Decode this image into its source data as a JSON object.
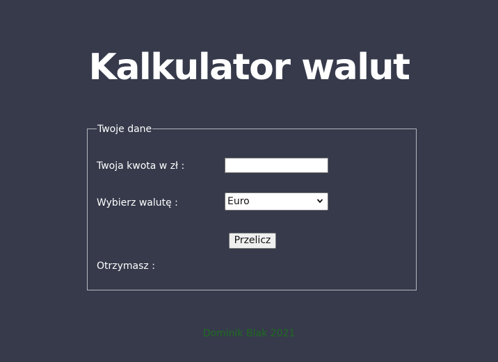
{
  "header": {
    "title": "Kalkulator walut"
  },
  "form": {
    "legend": "Twoje dane",
    "amount_label": "Twoja kwota w zł :",
    "amount_value": "",
    "currency_label": "Wybierz walutę :",
    "currency_selected": "Euro",
    "calculate_label": "Przelicz",
    "result_label": "Otrzymasz :"
  },
  "footer": {
    "text": "Dominik Blak 2021"
  },
  "colors": {
    "background": "#363a4b",
    "text": "#ffffff",
    "footer_text": "#1f6b1f",
    "panel_border": "#b7b9c0"
  },
  "icons": {
    "select_arrow": "chevron-down-icon"
  }
}
